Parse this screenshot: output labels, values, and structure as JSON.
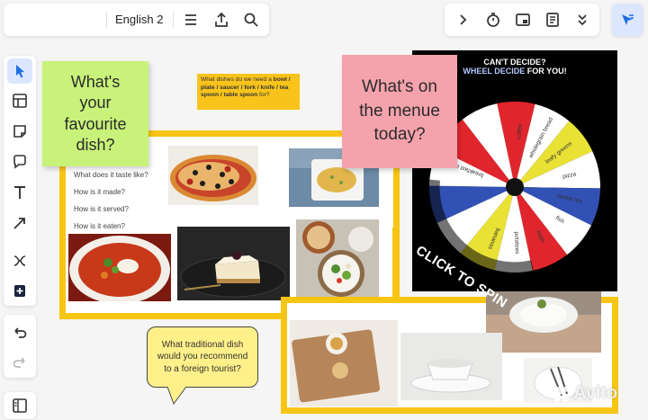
{
  "toolbar": {
    "language_label": "English 2"
  },
  "left_tools": {
    "select": "cursor-icon",
    "templates": "layout-icon",
    "sticky": "sticky-note-icon",
    "comment": "comment-icon",
    "text": "text-icon",
    "connector": "arrow-icon",
    "mindmap": "mindmap-icon",
    "add": "plus-icon",
    "undo": "undo-icon",
    "redo": "redo-icon",
    "panel": "sidebar-icon"
  },
  "stickies": {
    "favourite_dish": "What's your favourite dish?",
    "menu_today": "What's on the menue today?",
    "traditional_dish": "What traditional dish would you recommend to a foreign tourist?"
  },
  "note_dishes": {
    "before": "What dishes do we need a ",
    "bold": "bowl / plate / saucer / fork / knife / tea spoon / table spoon",
    "after": " for?"
  },
  "questions": [
    "What does it taste like?",
    "How is it made?",
    "How is it served?",
    "How is it eaten?"
  ],
  "wheel": {
    "title_line1": "CAN'T DECIDE?",
    "title_highlight": "WHEEL DECIDE",
    "title_rest": " FOR YOU!",
    "spin_label": "CLICK TO SPIN",
    "segments": [
      "coffee",
      "wholegrain bread",
      "leafy greens",
      "pizza",
      "herbal tea",
      "fish",
      "eggs",
      "potatoes",
      "bananas",
      "breakfast cereals"
    ],
    "colors": [
      "#e0262c",
      "#e9e235",
      "#3251b5",
      "#e0262c",
      "#e9e235",
      "#3251b5"
    ]
  },
  "watermark": "Avito",
  "colors": {
    "frame": "#f7c514",
    "sticky_green": "#c8f27a",
    "sticky_pink": "#f4a3ad",
    "sticky_yellow": "#fff08a",
    "accent": "#1f6fe0",
    "active_tool_bg": "#dde6ff"
  }
}
